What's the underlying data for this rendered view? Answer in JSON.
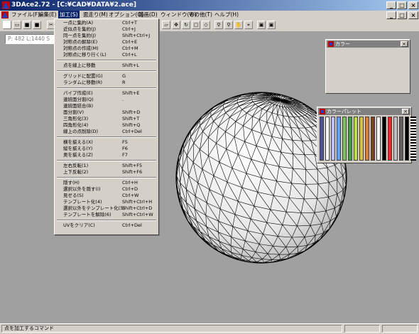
{
  "window": {
    "title": "3DAce2.72 - [C:¥CAD¥DATA¥2.ace]"
  },
  "menubar": [
    {
      "label": "ファイル(F)"
    },
    {
      "label": "編集(E)"
    },
    {
      "label": "加工(S)"
    },
    {
      "label": "面走り(M)"
    },
    {
      "label": "オプション(O)"
    },
    {
      "label": "描画(D)"
    },
    {
      "label": "ウィンドウ(W)"
    },
    {
      "label": "その他(T)"
    },
    {
      "label": "ヘルプ(H)"
    }
  ],
  "coords": "P: 482 L:1440 S",
  "menu": {
    "groups": [
      [
        {
          "label": "一点に集約(A)",
          "shortcut": "Ctrl+T"
        },
        {
          "label": "近似点を集約(J)",
          "shortcut": "Ctrl+J"
        },
        {
          "label": "同一点を集約(J)",
          "shortcut": "Shift+Ctrl+J"
        },
        {
          "label": "対称点の解除(E)",
          "shortcut": "Ctrl+E"
        },
        {
          "label": "対称点の作成(M)",
          "shortcut": "Ctrl+M"
        },
        {
          "label": "対称点に移り行く(L)",
          "shortcut": "Ctrl+L"
        }
      ],
      [
        {
          "label": "点を線上に移動",
          "shortcut": "Shift+L"
        }
      ],
      [
        {
          "label": "グリッドに配置(G)",
          "shortcut": "G"
        },
        {
          "label": "ランダムに移動(R)",
          "shortcut": "R"
        }
      ],
      [
        {
          "label": "パイプ作成(E)",
          "shortcut": "Shift+E"
        },
        {
          "label": "連続面分割(Q)",
          "shortcut": "."
        },
        {
          "label": "連続面結合(B)",
          "shortcut": ""
        },
        {
          "label": "面分割(V)",
          "shortcut": "Shift+D"
        },
        {
          "label": "三角形化(3)",
          "shortcut": "Shift+T"
        },
        {
          "label": "四角形化(4)",
          "shortcut": "Shift+Q"
        },
        {
          "label": "線上の点削除(D)",
          "shortcut": "Ctrl+Del"
        }
      ],
      [
        {
          "label": "横を揃える(X)",
          "shortcut": "F5"
        },
        {
          "label": "縦を揃える(Y)",
          "shortcut": "F6"
        },
        {
          "label": "奥を揃える(Z)",
          "shortcut": "F7"
        }
      ],
      [
        {
          "label": "左右反転(1)",
          "shortcut": "Shift+F5"
        },
        {
          "label": "上下反転(2)",
          "shortcut": "Shift+F6"
        }
      ],
      [
        {
          "label": "隠す(H)",
          "shortcut": "Ctrl+H"
        },
        {
          "label": "選択以外を隠す(I)",
          "shortcut": "Ctrl+D"
        },
        {
          "label": "見せる(S)",
          "shortcut": "Ctrl+W"
        },
        {
          "label": "テンプレート化(4)",
          "shortcut": "Shift+Ctrl+H"
        },
        {
          "label": "選択以外をテンプレート化(5)",
          "shortcut": "Shift+Ctrl+D"
        },
        {
          "label": "テンプレートを解除(6)",
          "shortcut": "Shift+Ctrl+W"
        }
      ],
      [
        {
          "label": "UVをクリア(C)",
          "shortcut": "Ctrl+Del"
        }
      ]
    ]
  },
  "color_window": {
    "title": "カラー"
  },
  "palette_window": {
    "title": "カラーパレット",
    "colors": [
      "#5050a0",
      "#ffffff",
      "#c0c0ff",
      "#60a0ff",
      "#80c060",
      "#40a040",
      "#c0e040",
      "#e0c040",
      "#e08030",
      "#804020",
      "#ffffff",
      "#000000",
      "#ff2020",
      "#c0c0c0",
      "#606060",
      "#000000"
    ]
  },
  "status": {
    "text": "点を加工するコマンド"
  }
}
